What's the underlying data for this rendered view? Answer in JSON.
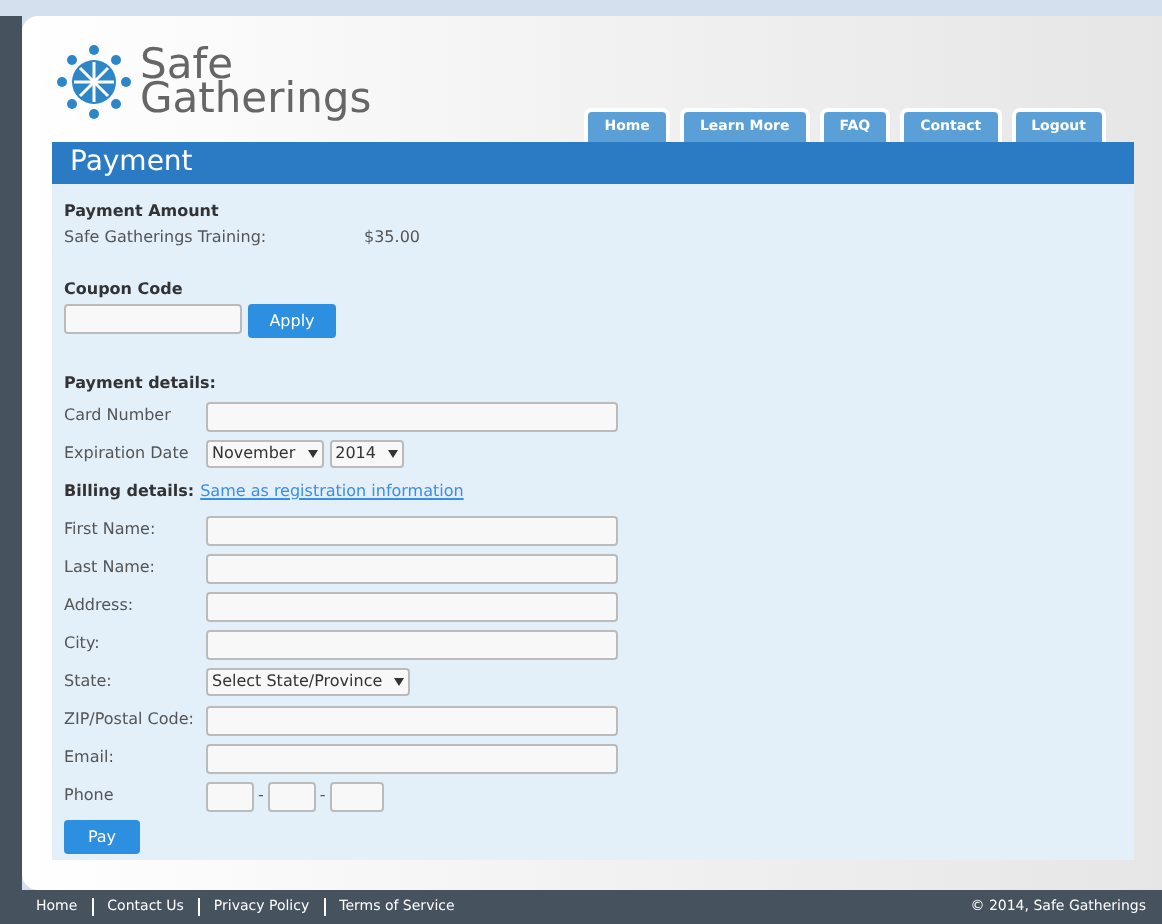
{
  "logo": {
    "line1": "Safe",
    "line2": "Gatherings"
  },
  "nav_tabs": [
    {
      "label": "Home"
    },
    {
      "label": "Learn More"
    },
    {
      "label": "FAQ"
    },
    {
      "label": "Contact"
    },
    {
      "label": "Logout"
    }
  ],
  "page_title": "Payment",
  "payment_amount": {
    "heading": "Payment Amount",
    "item_label": "Safe Gatherings Training:",
    "item_value": "$35.00"
  },
  "coupon": {
    "heading": "Coupon Code",
    "button": "Apply"
  },
  "payment_details": {
    "heading": "Payment details:",
    "fields": [
      {
        "label": "Card Number",
        "kind": "text"
      },
      {
        "label": "Expiration Date",
        "kind": "selects",
        "values": [
          "November",
          "2014"
        ]
      }
    ]
  },
  "billing": {
    "heading": "Billing details:",
    "link": "Same as registration information",
    "fields": [
      {
        "label": "First Name:",
        "kind": "text"
      },
      {
        "label": "Last Name:",
        "kind": "text"
      },
      {
        "label": "Address:",
        "kind": "text"
      },
      {
        "label": "City:",
        "kind": "text"
      },
      {
        "label": "State:",
        "kind": "selects",
        "values": [
          "Select State/Province"
        ]
      },
      {
        "label": "ZIP/Postal Code:",
        "kind": "text"
      },
      {
        "label": "Email:",
        "kind": "text"
      },
      {
        "label": "Phone",
        "kind": "phone",
        "separator": "-"
      }
    ]
  },
  "pay_button": "Pay",
  "footer": {
    "links": [
      "Home",
      "Contact Us",
      "Privacy Policy",
      "Terms of Service"
    ],
    "copyright": "© 2014, Safe Gatherings"
  }
}
